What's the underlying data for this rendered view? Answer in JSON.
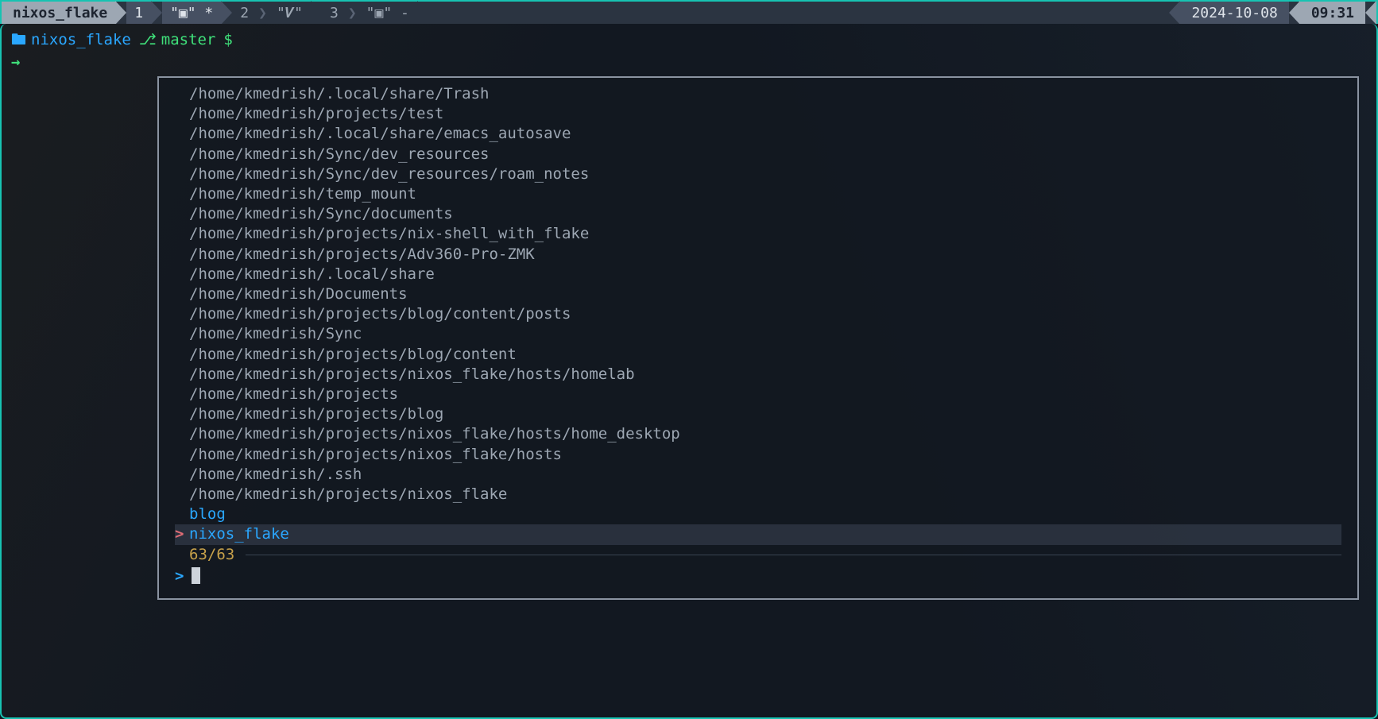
{
  "status": {
    "session": "nixos_flake",
    "windows": [
      {
        "index": "1",
        "name": "\"▣\" *",
        "active": true
      },
      {
        "index": "2",
        "name": "\"𝑽\"",
        "active": false
      },
      {
        "index": "3",
        "name": "\"▣\" -",
        "active": false
      }
    ],
    "date": "2024-10-08",
    "time": "09:31"
  },
  "prompt": {
    "cwd": "nixos_flake",
    "branch": "master",
    "symbol": "$"
  },
  "fzf": {
    "items": [
      "/home/kmedrish/.local/share/Trash",
      "/home/kmedrish/projects/test",
      "/home/kmedrish/.local/share/emacs_autosave",
      "/home/kmedrish/Sync/dev_resources",
      "/home/kmedrish/Sync/dev_resources/roam_notes",
      "/home/kmedrish/temp_mount",
      "/home/kmedrish/Sync/documents",
      "/home/kmedrish/projects/nix-shell_with_flake",
      "/home/kmedrish/projects/Adv360-Pro-ZMK",
      "/home/kmedrish/.local/share",
      "/home/kmedrish/Documents",
      "/home/kmedrish/projects/blog/content/posts",
      "/home/kmedrish/Sync",
      "/home/kmedrish/projects/blog/content",
      "/home/kmedrish/projects/nixos_flake/hosts/homelab",
      "/home/kmedrish/projects",
      "/home/kmedrish/projects/blog",
      "/home/kmedrish/projects/nixos_flake/hosts/home_desktop",
      "/home/kmedrish/projects/nixos_flake/hosts",
      "/home/kmedrish/.ssh",
      "/home/kmedrish/projects/nixos_flake"
    ],
    "named_items": [
      {
        "label": "blog",
        "selected": false
      },
      {
        "label": "nixos_flake",
        "selected": true
      }
    ],
    "count": "63/63",
    "query": ""
  }
}
